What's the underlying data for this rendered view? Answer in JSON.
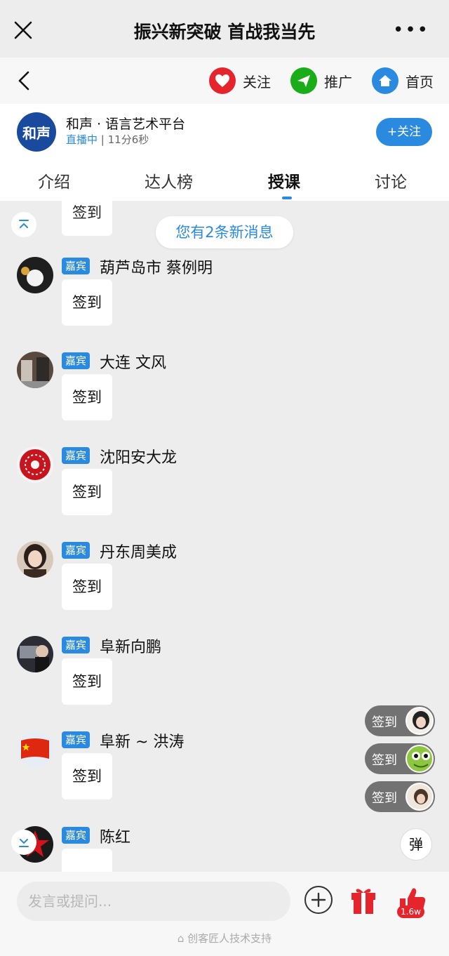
{
  "window": {
    "title": "振兴新突破 首战我当先",
    "close_icon": "close-icon",
    "more_icon": "more-icon"
  },
  "nav": {
    "back_icon": "back-arrow-icon",
    "actions": [
      {
        "label": "关注",
        "icon": "heart-icon",
        "color": "#e5242b"
      },
      {
        "label": "推广",
        "icon": "send-icon",
        "color": "#1aad19"
      },
      {
        "label": "首页",
        "icon": "home-icon",
        "color": "#2a8ae0"
      }
    ]
  },
  "channel": {
    "logo_text": "和声",
    "name": "和声 · 语言艺术平台",
    "status": "直播中",
    "duration": " | 11分6秒",
    "follow_label": "+关注"
  },
  "tabs": [
    {
      "label": "介绍",
      "active": false
    },
    {
      "label": "达人榜",
      "active": false
    },
    {
      "label": "授课",
      "active": true
    },
    {
      "label": "讨论",
      "active": false
    }
  ],
  "chat": {
    "first_message": "签到",
    "new_messages_notice": "您有2条新消息",
    "messages": [
      {
        "badge": "嘉宾",
        "name": "葫芦岛市 蔡例明",
        "text": "签到"
      },
      {
        "badge": "嘉宾",
        "name": "大连 文风",
        "text": "签到"
      },
      {
        "badge": "嘉宾",
        "name": "沈阳安大龙",
        "text": "签到"
      },
      {
        "badge": "嘉宾",
        "name": "丹东周美成",
        "text": "签到"
      },
      {
        "badge": "嘉宾",
        "name": "阜新向鹏",
        "text": "签到"
      },
      {
        "badge": "嘉宾",
        "name": "阜新 ~ 洪涛",
        "text": "签到"
      },
      {
        "badge": "嘉宾",
        "name": "陈红",
        "text": ""
      }
    ]
  },
  "floating_signins": [
    "签到",
    "签到",
    "签到"
  ],
  "danmu_label": "弹",
  "bottom": {
    "input_placeholder": "发言或提问...",
    "like_count": "1.6w",
    "footer": "创客匠人技术支持"
  },
  "colors": {
    "accent": "#2a8ae0",
    "red": "#e5242b",
    "green": "#1aad19"
  }
}
